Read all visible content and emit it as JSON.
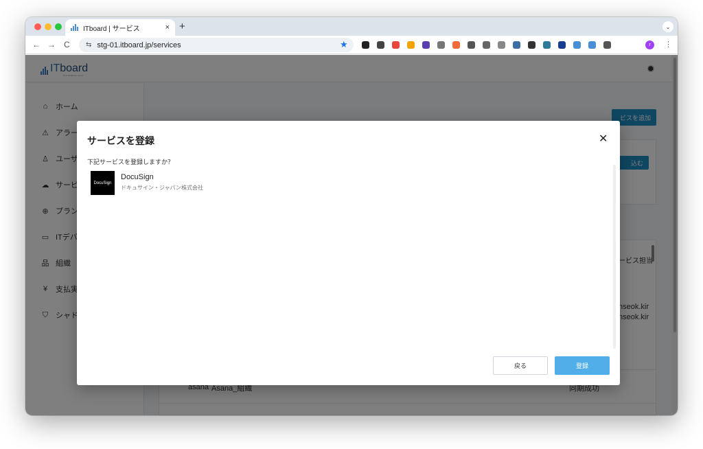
{
  "browser": {
    "tab_title": "ITboard | サービス",
    "tab_close": "×",
    "new_tab": "+",
    "tab_menu": "⌄",
    "back": "←",
    "forward": "→",
    "reload": "C",
    "site_info": "⇆",
    "url": "stg-01.itboard.jp/services",
    "bookmark": "★",
    "profile_initial": "r",
    "menu": "⋮",
    "extensions": [
      {
        "name": "extension-1",
        "color": "#222222"
      },
      {
        "name": "extension-2",
        "color": "#444444"
      },
      {
        "name": "extension-3",
        "color": "#e8453c"
      },
      {
        "name": "extension-4",
        "color": "#f4a300"
      },
      {
        "name": "extension-5",
        "color": "#5b3fb0"
      },
      {
        "name": "extension-6",
        "color": "#777777"
      },
      {
        "name": "extension-7",
        "color": "#f26b38"
      },
      {
        "name": "extension-8",
        "color": "#555555"
      },
      {
        "name": "extension-9",
        "color": "#666666"
      },
      {
        "name": "extension-10",
        "color": "#888888"
      },
      {
        "name": "extension-11",
        "color": "#3a6ea5"
      },
      {
        "name": "extension-12",
        "color": "#333333"
      },
      {
        "name": "extension-13",
        "color": "#2d7d9a"
      },
      {
        "name": "extension-14",
        "color": "#1a3e8f"
      },
      {
        "name": "extension-15",
        "color": "#4a8fd6"
      },
      {
        "name": "extension-16",
        "color": "#4a8fd6"
      },
      {
        "name": "extension-17",
        "color": "#555555"
      }
    ]
  },
  "app": {
    "logo_it": "IT",
    "logo_board": "board",
    "logo_tagline": "IT & Workforce Cloud",
    "settings_icon": "✹",
    "sidebar": [
      {
        "icon": "⌂",
        "label": "ホーム"
      },
      {
        "icon": "⚠",
        "label": "アラー"
      },
      {
        "icon": "♙",
        "label": "ユーザ"
      },
      {
        "icon": "☁",
        "label": "サービ"
      },
      {
        "icon": "⊕",
        "label": "プラン"
      },
      {
        "icon": "▭",
        "label": "ITデバ"
      },
      {
        "icon": "品",
        "label": "組織"
      },
      {
        "icon": "¥",
        "label": "支払実"
      },
      {
        "icon": "⛉",
        "label": "シャド"
      }
    ],
    "add_service_button": "ビスを追加",
    "import_button": "込む",
    "column_owner": "ービス担当",
    "owner_lines": [
      "nseok.kir",
      "nseok.kir"
    ],
    "rows": [
      {
        "logo_text": "asana",
        "name": "Asana_組織",
        "status": "同期成功"
      }
    ]
  },
  "modal": {
    "title": "サービスを登録",
    "close": "✕",
    "question": "下記サービスを登録しますか？",
    "services": [
      {
        "logo_text": "DocuSign",
        "name": "DocuSign",
        "company": "ドキュサイン・ジャパン株式会社"
      }
    ],
    "back_button": "戻る",
    "register_button": "登録"
  }
}
